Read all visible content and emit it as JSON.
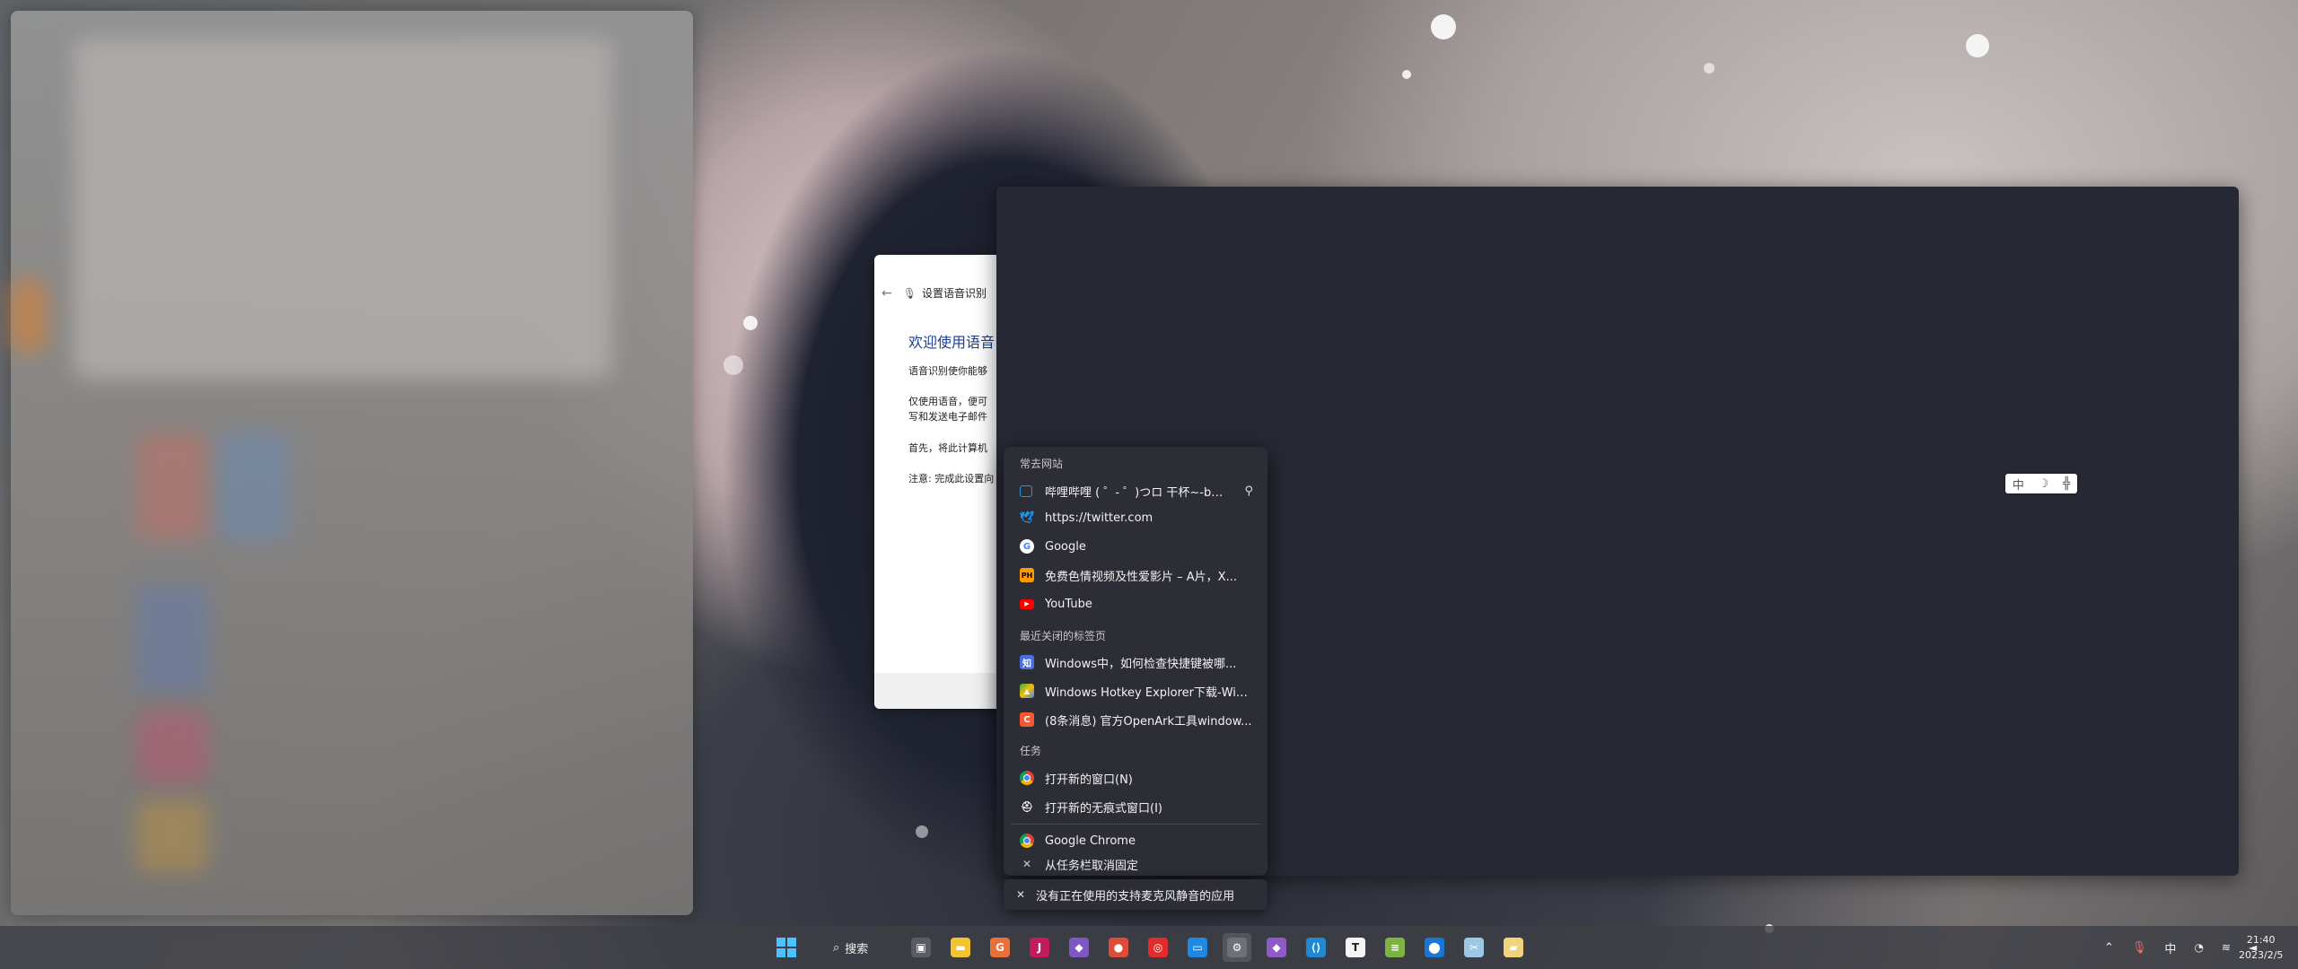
{
  "speech_window": {
    "header": "设置语音识别",
    "title": "欢迎使用语音",
    "paragraphs": [
      "语音识别使你能够",
      "仅使用语音，便可",
      "写和发送电子邮件",
      "首先，将此计算机",
      "注意: 完成此设置向"
    ]
  },
  "ime_bar": {
    "items": [
      "中",
      "☽",
      "╬"
    ]
  },
  "jumplist": {
    "sections": {
      "frequent": "常去网站",
      "recent": "最近关闭的标签页",
      "tasks": "任务"
    },
    "frequent_items": [
      {
        "label": "哔哩哔哩 ( ゜- ゜)つロ 干杯~-bi...",
        "icon": "bilibili-icon",
        "color": "#2a94d9"
      },
      {
        "label": "https://twitter.com",
        "icon": "twitter-icon",
        "color": "#1d9bf0"
      },
      {
        "label": "Google",
        "icon": "google-icon",
        "color": "#ffffff"
      },
      {
        "label": "免费色情视频及性爱影片 – A片，X...",
        "icon": "ph-icon",
        "color": "#ff9900"
      },
      {
        "label": "YouTube",
        "icon": "youtube-icon",
        "color": "#ff0000"
      }
    ],
    "recent_items": [
      {
        "label": "Windows中，如何检查快捷键被哪...",
        "icon": "zhihu-icon",
        "color": "#4a6ee0"
      },
      {
        "label": "Windows Hotkey Explorer下载-Win...",
        "icon": "hotkey-icon",
        "color": "#35a853"
      },
      {
        "label": "(8条消息) 官方OpenArk工具window...",
        "icon": "csdn-icon",
        "color": "#fc5531"
      }
    ],
    "task_items": [
      {
        "label": "打开新的窗口(N)",
        "icon": "chrome-icon"
      },
      {
        "label": "打开新的无痕式窗口(I)",
        "icon": "incognito-icon"
      }
    ],
    "app_item": {
      "label": "Google Chrome",
      "icon": "chrome-icon"
    },
    "unpin_item": {
      "label": "从任务栏取消固定",
      "icon": "unpin-icon"
    }
  },
  "mic_tip": {
    "label": "没有正在使用的支持麦克风静音的应用"
  },
  "taskbar": {
    "search_label": "搜索",
    "apps": [
      {
        "name": "task-view",
        "glyph": "▣",
        "color": "#5a5c63"
      },
      {
        "name": "file-explorer",
        "glyph": "▬",
        "color": "#f4c430"
      },
      {
        "name": "google-app",
        "glyph": "G",
        "color": "#e8703a"
      },
      {
        "name": "jetbrains",
        "glyph": "J",
        "color": "#c41b5e"
      },
      {
        "name": "visual-studio",
        "glyph": "◆",
        "color": "#7e57c2"
      },
      {
        "name": "chrome",
        "glyph": "●",
        "color": "#dd4b39"
      },
      {
        "name": "netease-music",
        "glyph": "◎",
        "color": "#e22b2b"
      },
      {
        "name": "remote-desktop",
        "glyph": "▭",
        "color": "#1e88e5"
      },
      {
        "name": "settings",
        "glyph": "⚙",
        "color": "#6e7079"
      },
      {
        "name": "vs-preview",
        "glyph": "◆",
        "color": "#8e5ac8"
      },
      {
        "name": "vscode",
        "glyph": "⟨⟩",
        "color": "#1f8ad2"
      },
      {
        "name": "typora",
        "glyph": "T",
        "color": "#f5f5f5"
      },
      {
        "name": "notepad",
        "glyph": "≡",
        "color": "#7cb342"
      },
      {
        "name": "maps",
        "glyph": "⬤",
        "color": "#1976d2"
      },
      {
        "name": "snipping",
        "glyph": "✂",
        "color": "#9ec7e6"
      },
      {
        "name": "sticky",
        "glyph": "▰",
        "color": "#f0d37a"
      }
    ]
  },
  "tray": {
    "ime": "中",
    "chevron": "^"
  },
  "clock": {
    "time": "21:40",
    "date": "2023/2/5"
  }
}
